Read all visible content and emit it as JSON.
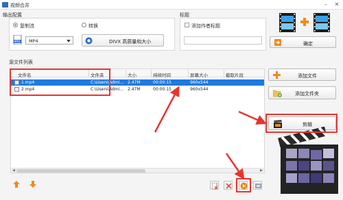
{
  "window": {
    "title": "视频合并"
  },
  "output_settings": {
    "group_title": "输出配置",
    "mode_copy": "复制流",
    "mode_convert": "转换",
    "format_value": "MP4",
    "quality_button": "DIVX 高质量和大小"
  },
  "title_section": {
    "group_title": "标题",
    "add_author_label": "添加作者标题",
    "title_value": ""
  },
  "confirm_button": "确定",
  "source_list": {
    "group_title": "源文件列表",
    "columns": [
      "文件名",
      "文件夹",
      "大小",
      "持续时间",
      "屏幕大小",
      "截取片段"
    ],
    "rows": [
      {
        "name": "1.mp4",
        "folder": "C:\\Users\\Admi...",
        "size": "2.47M",
        "duration": "00:00:15",
        "screen": "960x544",
        "clip": ""
      },
      {
        "name": "2.mp4",
        "folder": "C:\\Users\\Admi...",
        "size": "2.47M",
        "duration": "00:00:15",
        "screen": "960x544",
        "clip": ""
      }
    ],
    "selected_row": 0
  },
  "side_buttons": {
    "add_file": "添加文件",
    "add_folder": "添加文件夹",
    "edit": "剪辑"
  },
  "colors": {
    "highlight": "#e8342f",
    "selection": "#1f7ae0",
    "accent_orange": "#f08a1c"
  }
}
